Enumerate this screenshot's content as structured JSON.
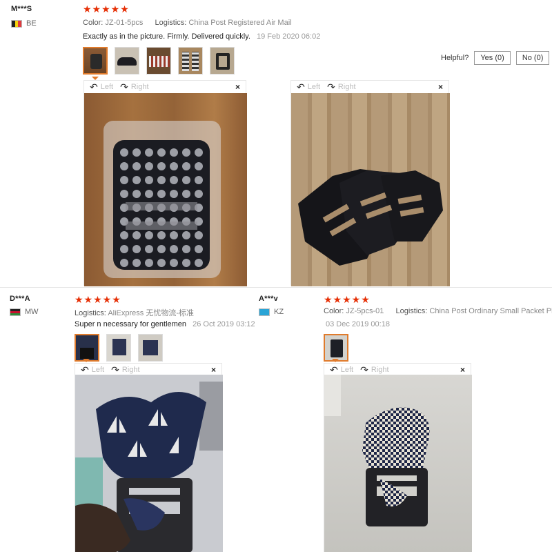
{
  "reviews": [
    {
      "user": "M***S",
      "country": "BE",
      "stars": "★★★★★",
      "color_label": "Color:",
      "color_value": "JZ-01-5pcs",
      "logistics_label": "Logistics:",
      "logistics_value": "China Post Registered Air Mail",
      "text": "Exactly as in the picture. Firmly. Delivered quickly.",
      "date": "19 Feb 2020 06:02",
      "helpful_label": "Helpful?",
      "yes_label": "Yes (0)",
      "no_label": "No (0)"
    },
    {
      "user": "D***A",
      "country": "MW",
      "stars": "★★★★★",
      "logistics_label": "Logistics:",
      "logistics_value": "AliExpress 无忧物流-标准",
      "text": "Super n necessary for gentlemen",
      "date": "26 Oct 2019 03:12"
    },
    {
      "user": "A***v",
      "country": "KZ",
      "stars": "★★★★★",
      "color_label": "Color:",
      "color_value": "JZ-5pcs-01",
      "logistics_label": "Logistics:",
      "logistics_value": "China Post Ordinary Small Packet Plus",
      "date": "03 Dec 2019 00:18"
    }
  ],
  "viewer": {
    "left_label": "Left",
    "right_label": "Right",
    "close_label": "×",
    "rotate_left_icon": "rotate-left-icon",
    "rotate_right_icon": "rotate-right-icon"
  },
  "colors": {
    "star": "#e62e04",
    "thumb_active": "#e07b2c"
  }
}
